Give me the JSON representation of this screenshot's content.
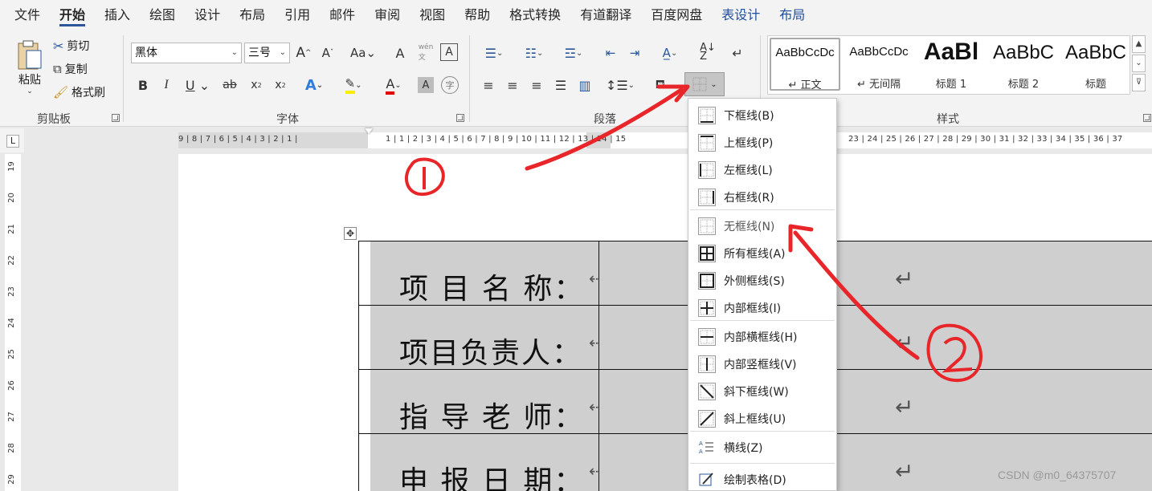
{
  "menubar": {
    "tabs": [
      "文件",
      "开始",
      "插入",
      "绘图",
      "设计",
      "布局",
      "引用",
      "邮件",
      "审阅",
      "视图",
      "帮助",
      "格式转换",
      "有道翻译",
      "百度网盘",
      "表设计",
      "布局"
    ],
    "active_index": 1,
    "contextual_indices": [
      14,
      15
    ]
  },
  "ribbon": {
    "clipboard": {
      "paste": "粘贴",
      "cut": "剪切",
      "copy": "复制",
      "format_painter": "格式刷",
      "group": "剪贴板"
    },
    "font": {
      "font_name": "黑体",
      "font_size": "三号",
      "group": "字体"
    },
    "paragraph": {
      "group": "段落"
    },
    "styles": {
      "group": "样式",
      "items": [
        {
          "sample": "AaBbCcDc",
          "name": "↵ 正文"
        },
        {
          "sample": "AaBbCcDc",
          "name": "↵ 无间隔"
        },
        {
          "sample": "AaBl",
          "name": "标题 1"
        },
        {
          "sample": "AaBbC",
          "name": "标题 2"
        },
        {
          "sample": "AaBbC",
          "name": "标题"
        }
      ]
    }
  },
  "ruler": {
    "left_numbers": "9 | 8 | 7 | 6 | 5 | 4 | 3 | 2 | 1 |",
    "right_numbers": "1 | 1 | 2 | 3 | 4 | 5 | 6 | 7 | 8 | 9 | 10 | 11 | 12 | 13 | 14 | 15",
    "right_tail": "23 | 24 | 25 | 26 | 27 | 28 | 29 | 30 | 31 | 32 | 33 | 34 | 35 | 36 | 37",
    "vertical_numbers": [
      "19",
      "20",
      "21",
      "22",
      "23",
      "24",
      "25",
      "26",
      "27",
      "28",
      "29"
    ]
  },
  "table": {
    "rows": [
      "项 目 名 称：",
      "项目负责人：",
      "指 导 老 师：",
      "申 报 日 期："
    ]
  },
  "border_menu": {
    "items": [
      {
        "label": "下框线(B)",
        "icon": "bottom-border-icon"
      },
      {
        "label": "上框线(P)",
        "icon": "top-border-icon"
      },
      {
        "label": "左框线(L)",
        "icon": "left-border-icon"
      },
      {
        "label": "右框线(R)",
        "icon": "right-border-icon"
      },
      {
        "label": "无框线(N)",
        "icon": "no-border-icon"
      },
      {
        "label": "所有框线(A)",
        "icon": "all-borders-icon"
      },
      {
        "label": "外侧框线(S)",
        "icon": "outside-borders-icon"
      },
      {
        "label": "内部框线(I)",
        "icon": "inside-borders-icon"
      },
      {
        "label": "内部横框线(H)",
        "icon": "inside-horizontal-border-icon"
      },
      {
        "label": "内部竖框线(V)",
        "icon": "inside-vertical-border-icon"
      },
      {
        "label": "斜下框线(W)",
        "icon": "diagonal-down-border-icon"
      },
      {
        "label": "斜上框线(U)",
        "icon": "diagonal-up-border-icon"
      },
      {
        "label": "横线(Z)",
        "icon": "horizontal-line-icon"
      },
      {
        "label": "绘制表格(D)",
        "icon": "draw-table-icon"
      }
    ]
  },
  "watermark": "CSDN @m0_64375707",
  "colors": {
    "accent": "#2b579a",
    "annotation": "#e8262a",
    "cell_shade": "#cfcfcf"
  }
}
